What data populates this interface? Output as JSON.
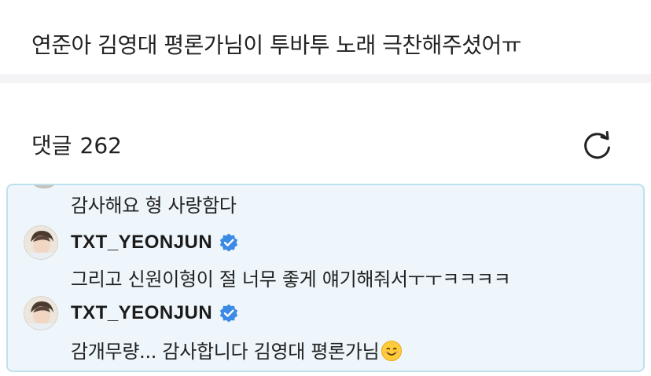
{
  "post": {
    "title": "연준아 김영대 평론가님이 투바투 노래 극찬해주셨어ㅠ"
  },
  "comments": {
    "label": "댓글",
    "count": "262",
    "refresh_icon": "refresh-icon"
  },
  "thread": {
    "lines": [
      {
        "type": "text",
        "text": "감사해요 형 사랑함다"
      },
      {
        "type": "author",
        "username": "TXT_YEONJUN",
        "verified": true
      },
      {
        "type": "text",
        "text": "그리고 신원이형이 절 너무 좋게 얘기해줘서ㅜㅜㅋㅋㅋㅋ"
      },
      {
        "type": "author",
        "username": "TXT_YEONJUN",
        "verified": true
      },
      {
        "type": "text",
        "text": "감개무량... 감사합니다 김영대 평론가님",
        "emoji": "smiling-face-icon"
      }
    ]
  },
  "colors": {
    "thread_bg": "#eef6fb",
    "thread_border": "#bfe0ee",
    "verified_badge": "#3b8ae6",
    "divider": "#f4f4f6"
  }
}
